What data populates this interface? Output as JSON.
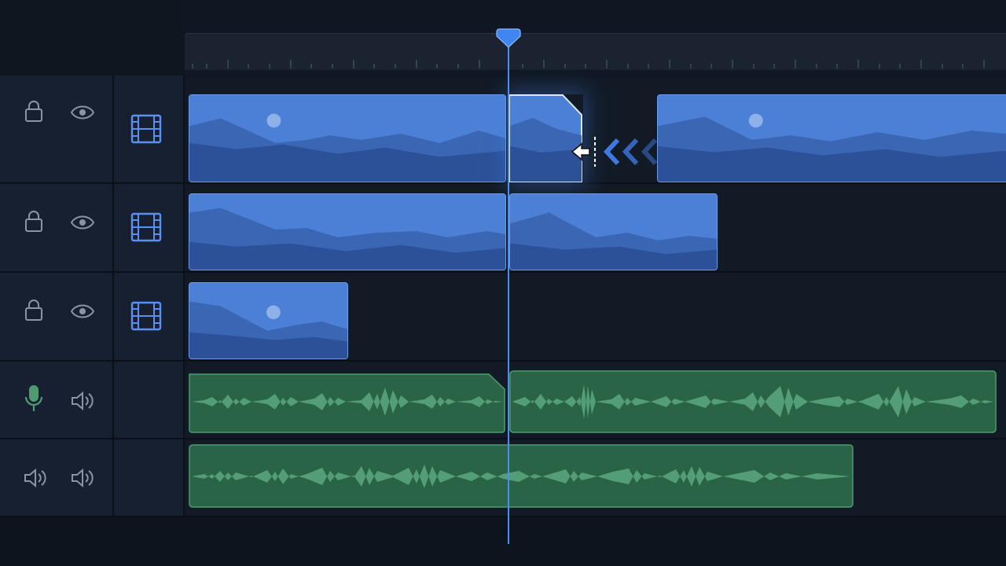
{
  "timeline": {
    "ruler": {
      "label": ""
    },
    "playhead": {
      "name": "playhead"
    },
    "tracks": [
      {
        "kind": "video",
        "icons": [
          "lock-icon",
          "eye-icon",
          "film-icon"
        ]
      },
      {
        "kind": "video",
        "icons": [
          "lock-icon",
          "eye-icon",
          "film-icon"
        ]
      },
      {
        "kind": "video",
        "icons": [
          "lock-icon",
          "eye-icon",
          "film-icon"
        ]
      },
      {
        "kind": "audio",
        "icons": [
          "microphone-icon",
          "speaker-icon"
        ]
      },
      {
        "kind": "audio",
        "icons": [
          "speaker-icon",
          "speaker-icon"
        ]
      }
    ],
    "trim_action": {
      "cursor": "trim-cursor-icon",
      "direction": "ripple-left-arrows"
    }
  },
  "colors": {
    "background": "#101722",
    "video_clip": "#3b6fc4",
    "audio_clip": "#2a6446",
    "playhead": "#4a8ff0"
  }
}
